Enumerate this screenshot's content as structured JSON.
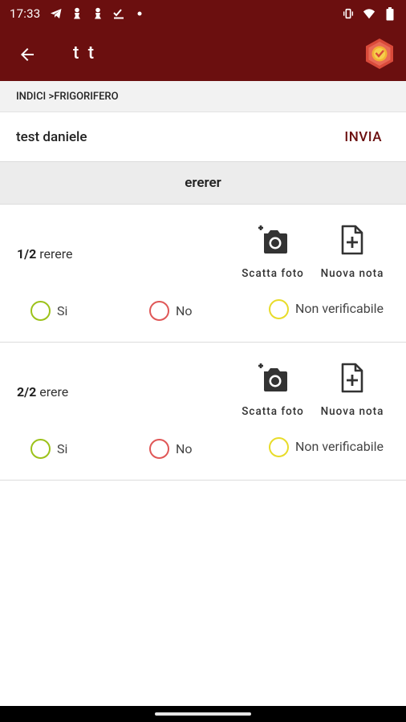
{
  "status_bar": {
    "time": "17:33",
    "left_icons": [
      "telegram-icon",
      "chess-pawn-icon",
      "chess-pawn-icon",
      "checklist-icon",
      "dot-icon"
    ],
    "right_icons": [
      "vibrate-icon",
      "wifi-icon",
      "battery-icon"
    ]
  },
  "app_bar": {
    "title": "t t",
    "back_icon": "arrow-back-icon",
    "logo": "app-logo-hexagon",
    "color": "#6b0f0f"
  },
  "breadcrumb": "INDICI >FRIGORIFERO",
  "info_row": {
    "name": "test daniele",
    "send_label": "INVIA"
  },
  "section": {
    "title": "ererer"
  },
  "questions": [
    {
      "number": "1/2",
      "text": "rerere",
      "photo_label": "Scatta foto",
      "note_label": "Nuova nota",
      "options": {
        "si": "Si",
        "no": "No",
        "nv": "Non verificabile"
      }
    },
    {
      "number": "2/2",
      "text": "erere",
      "photo_label": "Scatta foto",
      "note_label": "Nuova nota",
      "options": {
        "si": "Si",
        "no": "No",
        "nv": "Non verificabile"
      }
    }
  ],
  "colors": {
    "primary": "#6b0f0f",
    "si": "#9cc21a",
    "no": "#e05757",
    "nv": "#e8dc2a"
  }
}
